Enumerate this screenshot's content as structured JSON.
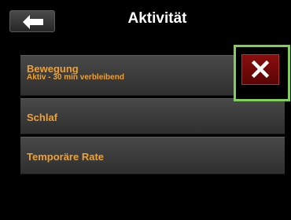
{
  "header": {
    "title": "Aktivität",
    "back_icon": "arrow-left-icon"
  },
  "items": [
    {
      "title": "Bewegung",
      "subtitle": "Aktiv - 30 min verbleibend"
    },
    {
      "title": "Schlaf"
    },
    {
      "title": "Temporäre Rate"
    }
  ],
  "close_icon": "close-icon",
  "colors": {
    "item_text": "#f0a030",
    "highlight": "#7fcf5c",
    "close_bg": "#8a0e0e"
  }
}
